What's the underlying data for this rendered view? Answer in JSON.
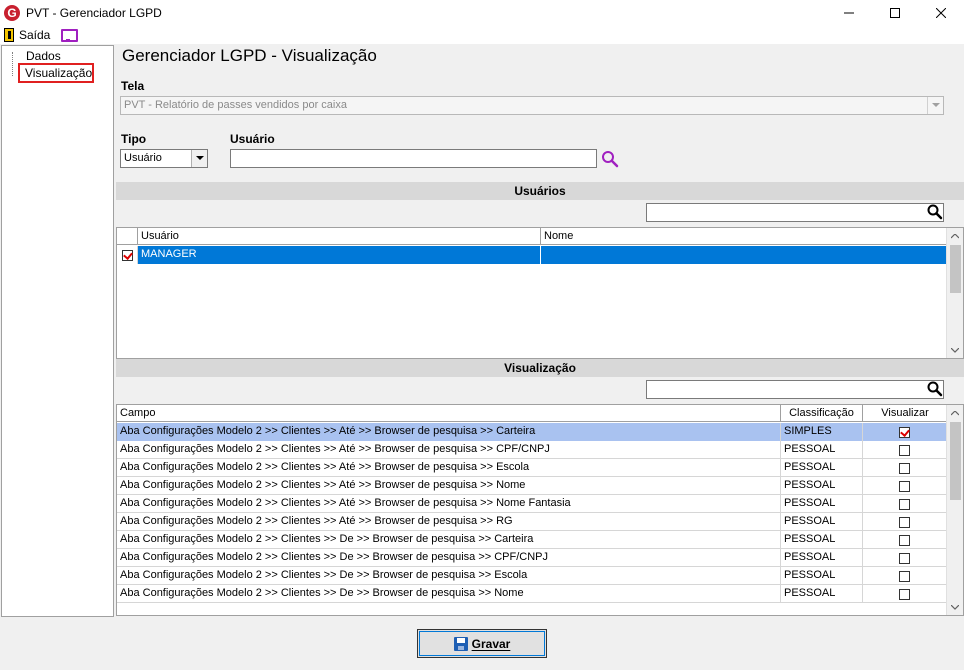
{
  "window": {
    "title": "PVT - Gerenciador LGPD"
  },
  "toolbar": {
    "exit_label": "Saída"
  },
  "tree": {
    "items": [
      {
        "label": "Dados"
      },
      {
        "label": "Visualização"
      }
    ]
  },
  "main": {
    "title": "Gerenciador LGPD - Visualização",
    "tela_label": "Tela",
    "tela_value": "PVT - Relatório de passes vendidos por caixa",
    "tipo_label": "Tipo",
    "tipo_value": "Usuário",
    "usuario_label": "Usuário",
    "usuario_value": ""
  },
  "users_section": {
    "header": "Usuários",
    "filter_value": "",
    "columns": [
      "Usuário",
      "Nome"
    ],
    "rows": [
      {
        "checked": true,
        "usuario": "MANAGER",
        "nome": ""
      }
    ]
  },
  "view_section": {
    "header": "Visualização",
    "filter_value": "",
    "columns": [
      "Campo",
      "Classificação",
      "Visualizar"
    ],
    "rows": [
      {
        "campo": "Aba Configurações Modelo 2 >> Clientes >> Até >> Browser de pesquisa >> Carteira",
        "classificacao": "SIMPLES",
        "visualizar": true
      },
      {
        "campo": "Aba Configurações Modelo 2 >> Clientes >> Até >> Browser de pesquisa >> CPF/CNPJ",
        "classificacao": "PESSOAL",
        "visualizar": false
      },
      {
        "campo": "Aba Configurações Modelo 2 >> Clientes >> Até >> Browser de pesquisa >> Escola",
        "classificacao": "PESSOAL",
        "visualizar": false
      },
      {
        "campo": "Aba Configurações Modelo 2 >> Clientes >> Até >> Browser de pesquisa >> Nome",
        "classificacao": "PESSOAL",
        "visualizar": false
      },
      {
        "campo": "Aba Configurações Modelo 2 >> Clientes >> Até >> Browser de pesquisa >> Nome Fantasia",
        "classificacao": "PESSOAL",
        "visualizar": false
      },
      {
        "campo": "Aba Configurações Modelo 2 >> Clientes >> Até >> Browser de pesquisa >> RG",
        "classificacao": "PESSOAL",
        "visualizar": false
      },
      {
        "campo": "Aba Configurações Modelo 2 >> Clientes >> De >> Browser de pesquisa >> Carteira",
        "classificacao": "PESSOAL",
        "visualizar": false
      },
      {
        "campo": "Aba Configurações Modelo 2 >> Clientes >> De >> Browser de pesquisa >> CPF/CNPJ",
        "classificacao": "PESSOAL",
        "visualizar": false
      },
      {
        "campo": "Aba Configurações Modelo 2 >> Clientes >> De >> Browser de pesquisa >> Escola",
        "classificacao": "PESSOAL",
        "visualizar": false
      },
      {
        "campo": "Aba Configurações Modelo 2 >> Clientes >> De >> Browser de pesquisa >> Nome",
        "classificacao": "PESSOAL",
        "visualizar": false
      }
    ]
  },
  "footer": {
    "save_label": "Gravar"
  },
  "colors": {
    "selection_blue": "#0078d7",
    "selection_light": "#a9c2f0",
    "app_logo_red": "#c8202f",
    "search_icon_purple": "#a020c0"
  }
}
